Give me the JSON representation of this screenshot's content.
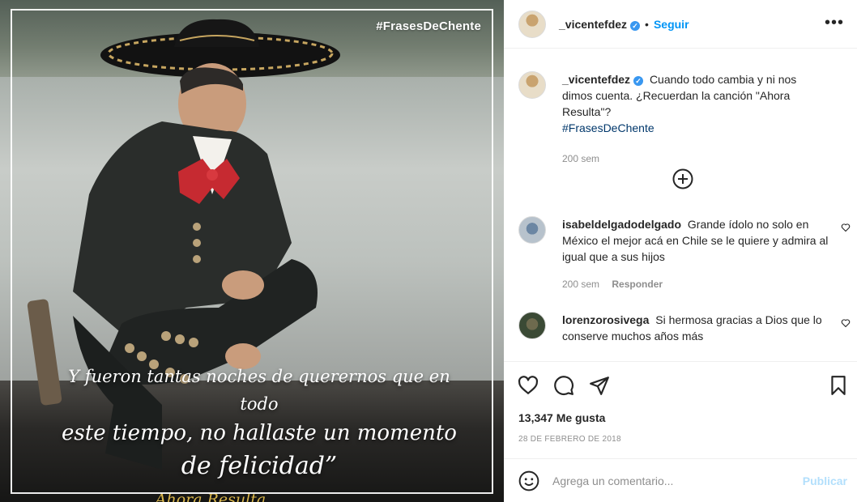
{
  "post_image": {
    "hashtag_overlay": "#FrasesDeChente",
    "quote": {
      "line1": "Y fueron tantas noches de querernos que en todo",
      "line2": "este tiempo, no hallaste un momento",
      "line3": "de felicidad”",
      "song": "Ahora Resulta"
    }
  },
  "header": {
    "username": "_vicentefdez",
    "verified_mark": "✓",
    "separator": "•",
    "follow_label": "Seguir",
    "more_label": "•••"
  },
  "caption": {
    "username": "_vicentefdez",
    "text": "Cuando todo cambia y ni nos dimos cuenta. ¿Recuerdan la canción \"Ahora Resulta\"?",
    "hashtag": "#FrasesDeChente",
    "time": "200 sem"
  },
  "comments": [
    {
      "username": "isabeldelgadodelgado",
      "text": "Grande ídolo no solo en México el mejor acá en Chile se le quiere y admira al igual que a sus hijos",
      "time": "200 sem",
      "reply_label": "Responder"
    },
    {
      "username": "lorenzorosivega",
      "text": "Si hermosa gracias a Dios que lo conserve muchos años más"
    }
  ],
  "actions": {
    "likes": "13,347 Me gusta",
    "date": "28 DE FEBRERO DE 2018"
  },
  "add_comment": {
    "placeholder": "Agrega un comentario...",
    "publish_label": "Publicar"
  },
  "colors": {
    "link_blue": "#0095f6",
    "publish_disabled": "#b2dffc",
    "verified": "#3897f0",
    "muted": "#8e8e8e"
  }
}
